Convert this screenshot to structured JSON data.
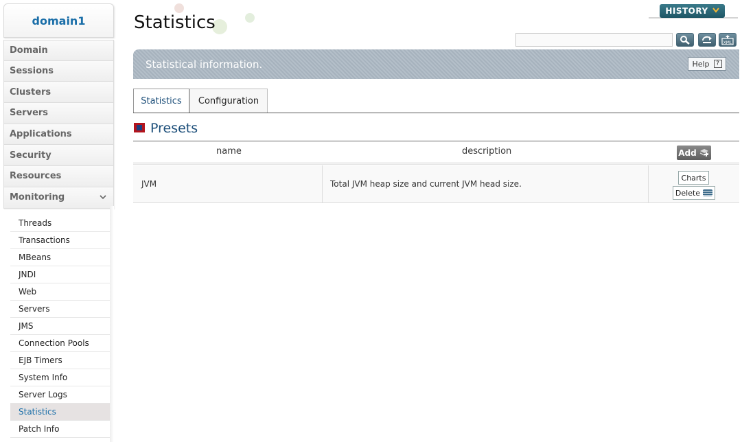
{
  "sidebar": {
    "domain": "domain1",
    "menu": [
      {
        "label": "Domain"
      },
      {
        "label": "Sessions"
      },
      {
        "label": "Clusters"
      },
      {
        "label": "Servers"
      },
      {
        "label": "Applications"
      },
      {
        "label": "Security"
      },
      {
        "label": "Resources"
      },
      {
        "label": "Monitoring",
        "expanded": true
      }
    ],
    "monitoring_items": [
      {
        "label": "Threads"
      },
      {
        "label": "Transactions"
      },
      {
        "label": "MBeans"
      },
      {
        "label": "JNDI"
      },
      {
        "label": "Web"
      },
      {
        "label": "Servers"
      },
      {
        "label": "JMS"
      },
      {
        "label": "Connection Pools"
      },
      {
        "label": "EJB Timers"
      },
      {
        "label": "System Info"
      },
      {
        "label": "Server Logs"
      },
      {
        "label": "Statistics",
        "active": true
      },
      {
        "label": "Patch Info"
      }
    ]
  },
  "header": {
    "title": "Statistics",
    "history_label": "HISTORY",
    "search_value": "",
    "info_text": "Statistical information.",
    "help_label": "Help"
  },
  "tabs": [
    {
      "label": "Statistics",
      "active": true
    },
    {
      "label": "Configuration",
      "active": false
    }
  ],
  "section": {
    "title": "Presets"
  },
  "table": {
    "columns": {
      "name": "name",
      "description": "description"
    },
    "add_label": "Add",
    "rows": [
      {
        "name": "JVM",
        "description": "Total JVM heap size and current JVM head size.",
        "charts_label": "Charts",
        "delete_label": "Delete"
      }
    ]
  },
  "colors": {
    "accent": "#1a6ea8",
    "title_blue": "#1d4f7a",
    "history_bg": "#1e5665",
    "info_bar": "#aeb9c3"
  }
}
